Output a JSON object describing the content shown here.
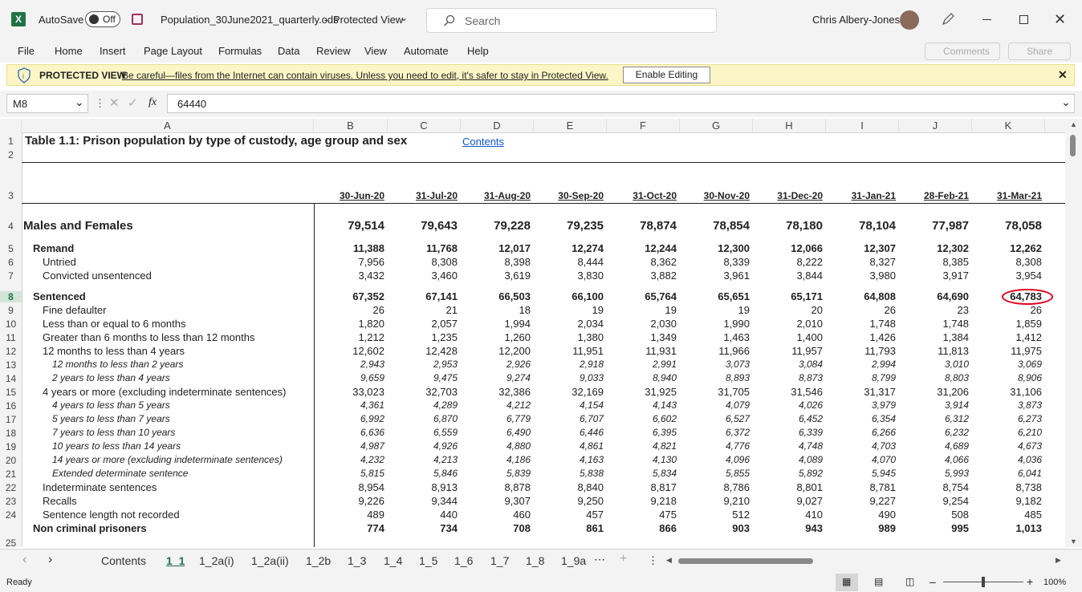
{
  "titlebar": {
    "autosave_label": "AutoSave",
    "autosave_state": "Off",
    "filename": "Population_30June2021_quarterly.ods",
    "mode": "Protected View",
    "search_placeholder": "Search",
    "user_name": "Chris Albery-Jones"
  },
  "menu": [
    "File",
    "Home",
    "Insert",
    "Page Layout",
    "Formulas",
    "Data",
    "Review",
    "View",
    "Automate",
    "Help"
  ],
  "ribbon_buttons": {
    "comments": "Comments",
    "share": "Share"
  },
  "protected_view": {
    "title": "PROTECTED VIEW",
    "message": "Be careful—files from the Internet can contain viruses. Unless you need to edit, it's safer to stay in Protected View.",
    "button": "Enable Editing"
  },
  "formula_bar": {
    "name_box": "M8",
    "fx": "fx",
    "value": "64440"
  },
  "columns": [
    "A",
    "B",
    "C",
    "D",
    "E",
    "F",
    "G",
    "H",
    "I",
    "J",
    "K"
  ],
  "sheet": {
    "title": "Table 1.1: Prison population by type of custody, age group and sex",
    "contents_link": "Contents",
    "dates": [
      "30-Jun-20",
      "31-Jul-20",
      "31-Aug-20",
      "30-Sep-20",
      "31-Oct-20",
      "30-Nov-20",
      "31-Dec-20",
      "31-Jan-21",
      "28-Feb-21",
      "31-Mar-21"
    ],
    "rows": [
      {
        "r": "4",
        "label": "Males and Females",
        "style": "big",
        "values": [
          "79,514",
          "79,643",
          "79,228",
          "79,235",
          "78,874",
          "78,854",
          "78,180",
          "78,104",
          "77,987",
          "78,058"
        ]
      },
      {
        "r": "5",
        "label": "Remand",
        "style": "bold",
        "indent": 1,
        "values": [
          "11,388",
          "11,768",
          "12,017",
          "12,274",
          "12,244",
          "12,300",
          "12,066",
          "12,307",
          "12,302",
          "12,262"
        ]
      },
      {
        "r": "6",
        "label": "Untried",
        "indent": 2,
        "values": [
          "7,956",
          "8,308",
          "8,398",
          "8,444",
          "8,362",
          "8,339",
          "8,222",
          "8,327",
          "8,385",
          "8,308"
        ]
      },
      {
        "r": "7",
        "label": "Convicted unsentenced",
        "indent": 2,
        "values": [
          "3,432",
          "3,460",
          "3,619",
          "3,830",
          "3,882",
          "3,961",
          "3,844",
          "3,980",
          "3,917",
          "3,954"
        ]
      },
      {
        "r": "8",
        "label": "Sentenced",
        "style": "bold",
        "indent": 1,
        "values": [
          "67,352",
          "67,141",
          "66,503",
          "66,100",
          "65,764",
          "65,651",
          "65,171",
          "64,808",
          "64,690",
          "64,783"
        ]
      },
      {
        "r": "9",
        "label": "Fine defaulter",
        "indent": 2,
        "values": [
          "26",
          "21",
          "18",
          "19",
          "19",
          "19",
          "20",
          "26",
          "23",
          "26"
        ]
      },
      {
        "r": "10",
        "label": "Less than or equal to 6 months",
        "indent": 2,
        "values": [
          "1,820",
          "2,057",
          "1,994",
          "2,034",
          "2,030",
          "1,990",
          "2,010",
          "1,748",
          "1,748",
          "1,859"
        ]
      },
      {
        "r": "11",
        "label": "Greater than 6 months to less than 12 months",
        "indent": 2,
        "values": [
          "1,212",
          "1,235",
          "1,260",
          "1,380",
          "1,349",
          "1,463",
          "1,400",
          "1,426",
          "1,384",
          "1,412"
        ]
      },
      {
        "r": "12",
        "label": "12 months to less than 4 years",
        "indent": 2,
        "values": [
          "12,602",
          "12,428",
          "12,200",
          "11,951",
          "11,931",
          "11,966",
          "11,957",
          "11,793",
          "11,813",
          "11,975"
        ]
      },
      {
        "r": "13",
        "label": "12 months to less than 2 years",
        "style": "italic",
        "indent": 3,
        "values": [
          "2,943",
          "2,953",
          "2,926",
          "2,918",
          "2,991",
          "3,073",
          "3,084",
          "2,994",
          "3,010",
          "3,069"
        ]
      },
      {
        "r": "14",
        "label": "2 years to less than 4 years",
        "style": "italic",
        "indent": 3,
        "values": [
          "9,659",
          "9,475",
          "9,274",
          "9,033",
          "8,940",
          "8,893",
          "8,873",
          "8,799",
          "8,803",
          "8,906"
        ]
      },
      {
        "r": "15",
        "label": "4 years or more (excluding indeterminate sentences)",
        "indent": 2,
        "values": [
          "33,023",
          "32,703",
          "32,386",
          "32,169",
          "31,925",
          "31,705",
          "31,546",
          "31,317",
          "31,206",
          "31,106"
        ]
      },
      {
        "r": "16",
        "label": "4 years to less than 5 years",
        "style": "italic",
        "indent": 3,
        "values": [
          "4,361",
          "4,289",
          "4,212",
          "4,154",
          "4,143",
          "4,079",
          "4,026",
          "3,979",
          "3,914",
          "3,873"
        ]
      },
      {
        "r": "17",
        "label": "5 years to less than 7 years",
        "style": "italic",
        "indent": 3,
        "values": [
          "6,992",
          "6,870",
          "6,779",
          "6,707",
          "6,602",
          "6,527",
          "6,452",
          "6,354",
          "6,312",
          "6,273"
        ]
      },
      {
        "r": "18",
        "label": "7 years to less than 10 years",
        "style": "italic",
        "indent": 3,
        "values": [
          "6,636",
          "6,559",
          "6,490",
          "6,446",
          "6,395",
          "6,372",
          "6,339",
          "6,266",
          "6,232",
          "6,210"
        ]
      },
      {
        "r": "19",
        "label": "10 years to less than 14 years",
        "style": "italic",
        "indent": 3,
        "values": [
          "4,987",
          "4,926",
          "4,880",
          "4,861",
          "4,821",
          "4,776",
          "4,748",
          "4,703",
          "4,689",
          "4,673"
        ]
      },
      {
        "r": "20",
        "label": "14 years or more (excluding indeterminate sentences)",
        "style": "italic",
        "indent": 3,
        "values": [
          "4,232",
          "4,213",
          "4,186",
          "4,163",
          "4,130",
          "4,096",
          "4,089",
          "4,070",
          "4,066",
          "4,036"
        ]
      },
      {
        "r": "21",
        "label": "Extended determinate sentence",
        "style": "italic",
        "indent": 3,
        "values": [
          "5,815",
          "5,846",
          "5,839",
          "5,838",
          "5,834",
          "5,855",
          "5,892",
          "5,945",
          "5,993",
          "6,041"
        ]
      },
      {
        "r": "22",
        "label": "Indeterminate sentences",
        "indent": 2,
        "values": [
          "8,954",
          "8,913",
          "8,878",
          "8,840",
          "8,817",
          "8,786",
          "8,801",
          "8,781",
          "8,754",
          "8,738"
        ]
      },
      {
        "r": "23",
        "label": "Recalls",
        "indent": 2,
        "values": [
          "9,226",
          "9,344",
          "9,307",
          "9,250",
          "9,218",
          "9,210",
          "9,027",
          "9,227",
          "9,254",
          "9,182"
        ]
      },
      {
        "r": "24",
        "label": "Sentence length not recorded",
        "indent": 2,
        "values": [
          "489",
          "440",
          "460",
          "457",
          "475",
          "512",
          "410",
          "490",
          "508",
          "485"
        ]
      },
      {
        "r": "",
        "label": "Non criminal prisoners",
        "style": "bold",
        "indent": 1,
        "values": [
          "774",
          "734",
          "708",
          "861",
          "866",
          "903",
          "943",
          "989",
          "995",
          "1,013"
        ]
      }
    ],
    "row_numbers": [
      "1",
      "2",
      "3",
      "4",
      "5",
      "6",
      "7",
      "8",
      "9",
      "10",
      "11",
      "12",
      "13",
      "14",
      "15",
      "16",
      "17",
      "18",
      "19",
      "20",
      "21",
      "22",
      "23",
      "24",
      "25"
    ]
  },
  "tabs": [
    "Contents",
    "1_1",
    "1_2a(i)",
    "1_2a(ii)",
    "1_2b",
    "1_3",
    "1_4",
    "1_5",
    "1_6",
    "1_7",
    "1_8",
    "1_9a"
  ],
  "active_tab": "1_1",
  "status": {
    "ready": "Ready",
    "zoom": "100%"
  },
  "colors": {
    "accent_green": "#217346",
    "highlight_red": "#e0001b",
    "link_blue": "#1155cc",
    "protected_yellow": "#fcf6c6"
  }
}
